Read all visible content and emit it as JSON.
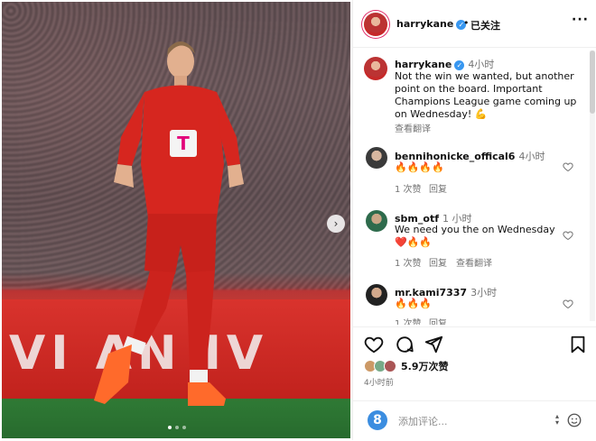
{
  "post": {
    "username": "harrykane",
    "follow_status": "已关注",
    "caption_time": "4小时",
    "caption": "Not the win we wanted, but another point on the board. Important Champions League game coming up on Wednesday!",
    "caption_emoji": "💪",
    "translate_label": "查看翻译"
  },
  "photo": {
    "board_text": "VI AN IV"
  },
  "comments": [
    {
      "username": "bennihonicke_offical6",
      "time": "4小时",
      "text": "",
      "emoji": "🔥🔥🔥🔥",
      "likes": "1 次赞",
      "reply": "回复",
      "translate": ""
    },
    {
      "username": "sbm_otf",
      "time": "1 小时",
      "text": "We need you the on Wednesday",
      "emoji": "❤️🔥🔥",
      "likes": "1 次赞",
      "reply": "回复",
      "translate": "查看翻译"
    },
    {
      "username": "mr.kami7337",
      "time": "3小时",
      "text": "",
      "emoji": "🔥🔥🔥",
      "likes": "1 次赞",
      "reply": "回复",
      "translate": ""
    }
  ],
  "footer": {
    "likes": "5.9万次赞",
    "posted": "4小时前",
    "add_comment_placeholder": "添加评论...",
    "badge": "8"
  },
  "icons": [
    "heart-icon",
    "comment-icon",
    "share-icon",
    "bookmark-icon",
    "emoji-icon",
    "more-icon",
    "verified-icon",
    "next-arrow-icon"
  ]
}
